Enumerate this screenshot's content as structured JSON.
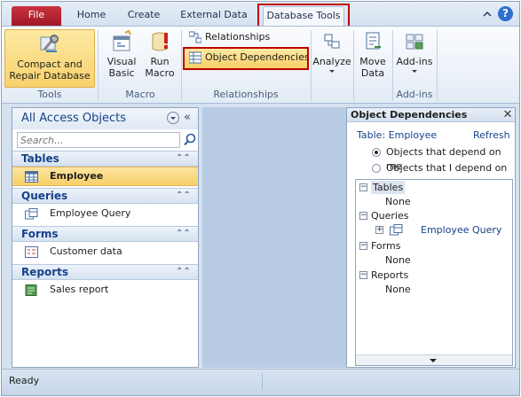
{
  "ribbon": {
    "tabs": [
      "File",
      "Home",
      "Create",
      "External Data",
      "Database Tools"
    ],
    "active_tab": "Database Tools",
    "groups": {
      "tools": {
        "label": "Tools",
        "compact_label_1": "Compact and",
        "compact_label_2": "Repair Database"
      },
      "macro": {
        "label": "Macro",
        "visual_basic_1": "Visual",
        "visual_basic_2": "Basic",
        "run_macro_1": "Run",
        "run_macro_2": "Macro"
      },
      "relationships": {
        "label": "Relationships",
        "relationships": "Relationships",
        "object_dependencies": "Object Dependencies"
      },
      "analyze": {
        "label": "Analyze"
      },
      "move_data": {
        "label_1": "Move",
        "label_2": "Data"
      },
      "addins": {
        "label": "Add-ins",
        "button": "Add-ins"
      }
    }
  },
  "nav": {
    "title": "All Access Objects",
    "search_placeholder": "Search...",
    "categories": [
      {
        "label": "Tables",
        "items": [
          {
            "label": "Employee",
            "icon": "table-icon",
            "selected": true
          }
        ]
      },
      {
        "label": "Queries",
        "items": [
          {
            "label": "Employee Query",
            "icon": "query-icon"
          }
        ]
      },
      {
        "label": "Forms",
        "items": [
          {
            "label": "Customer data",
            "icon": "form-icon"
          }
        ]
      },
      {
        "label": "Reports",
        "items": [
          {
            "label": "Sales report",
            "icon": "report-icon"
          }
        ]
      }
    ]
  },
  "dependencies": {
    "title": "Object Dependencies",
    "table_label": "Table: Employee",
    "refresh": "Refresh",
    "radio_1": "Objects that depend on me",
    "radio_2": "Objects that I depend on",
    "selected_radio": "Objects that depend on me",
    "tree": {
      "tables": {
        "label": "Tables",
        "child": "None"
      },
      "queries": {
        "label": "Queries",
        "child": "Employee Query"
      },
      "forms": {
        "label": "Forms",
        "child": "None"
      },
      "reports": {
        "label": "Reports",
        "child": "None"
      }
    }
  },
  "status": {
    "text": "Ready"
  },
  "colors": {
    "accent": "#c00000",
    "file_tab": "#b22030",
    "selection": "#f8cf6a",
    "link": "#15428b"
  }
}
